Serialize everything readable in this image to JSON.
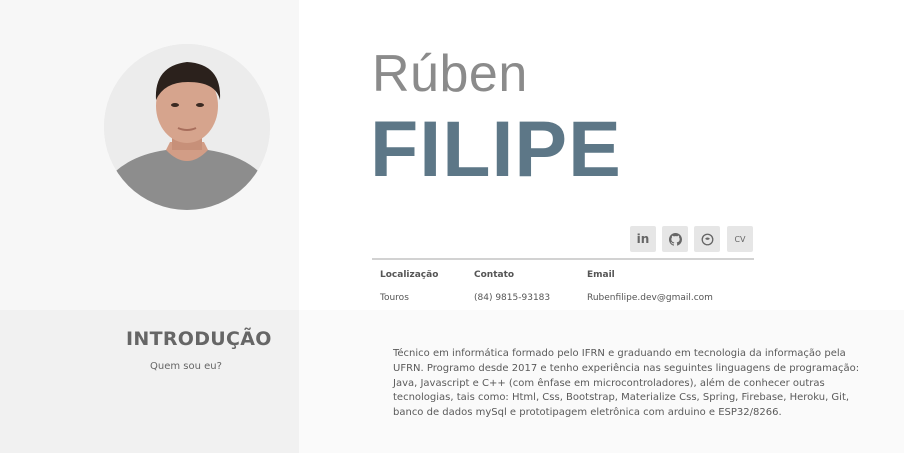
{
  "profile": {
    "first_name": "Rúben",
    "last_name": "FILIPE",
    "avatar_alt": "avatar"
  },
  "social": {
    "linkedin_label": "in",
    "cv_label": "CV",
    "icons": [
      "linkedin-icon",
      "github-icon",
      "chat-icon",
      "cv-icon"
    ]
  },
  "info": {
    "location_label": "Localização",
    "location_value": "Touros",
    "contact_label": "Contato",
    "contact_value": "(84) 9815-93183",
    "email_label": "Email",
    "email_value": "Rubenfilipe.dev@gmail.com"
  },
  "intro": {
    "title": "INTRODUÇÃO",
    "subtitle": "Quem sou eu?",
    "text": "Técnico em informática formado pelo IFRN e graduando em tecnologia da informação pela UFRN. Programo desde 2017 e tenho experiência nas seguintes linguagens de programação: Java, Javascript e C++ (com ênfase em microcontroladores), além de conhecer outras tecnologias, tais como: Html, Css, Bootstrap, Materialize Css, Spring, Firebase, Heroku, Git, banco de dados mySql e prototipagem eletrônica com arduino e ESP32/8266."
  },
  "colors": {
    "accent": "#5d7787",
    "first_name": "#8b8b8b"
  }
}
